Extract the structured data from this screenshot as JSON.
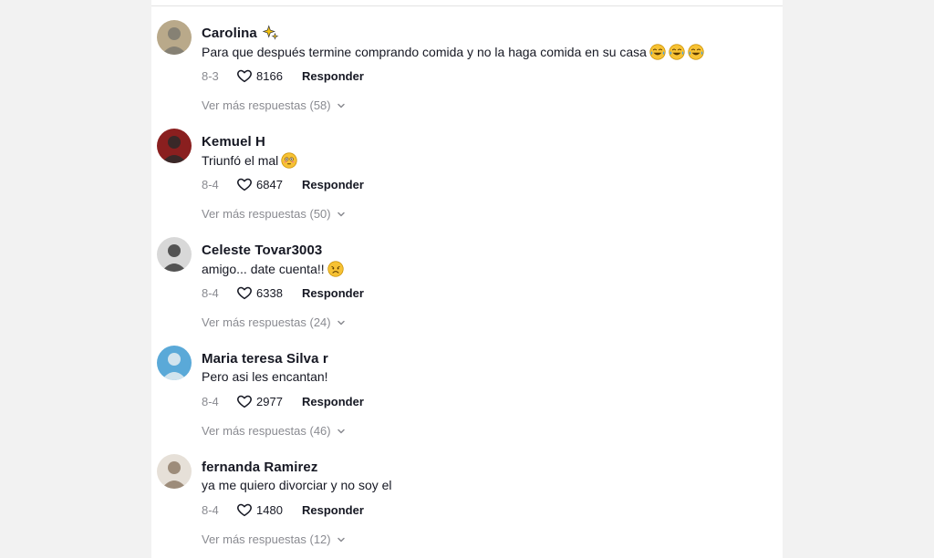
{
  "comments": [
    {
      "username": "Carolina",
      "badge_icon": "sparkle-star-icon",
      "text": "Para que después termine comprando comida y no la haga comida en su casa",
      "emojis": [
        "joy-emoji-icon",
        "joy-emoji-icon",
        "joy-emoji-icon"
      ],
      "date": "8-3",
      "likes": "8166",
      "reply_label": "Responder",
      "more_label": "Ver más respuestas (58)",
      "avatar_colors": [
        "#b9a98a",
        "#7d7a70"
      ]
    },
    {
      "username": "Kemuel H",
      "badge_icon": "",
      "text": "Triunfó el mal",
      "emojis": [
        "flushed-emoji-icon"
      ],
      "date": "8-4",
      "likes": "6847",
      "reply_label": "Responder",
      "more_label": "Ver más respuestas (50)",
      "avatar_colors": [
        "#8a1f1f",
        "#2a2a2a"
      ]
    },
    {
      "username": "Celeste Tovar3003",
      "badge_icon": "",
      "text": "amigo... date cuenta!!",
      "emojis": [
        "frowning-emoji-icon"
      ],
      "date": "8-4",
      "likes": "6338",
      "reply_label": "Responder",
      "more_label": "Ver más respuestas (24)",
      "avatar_colors": [
        "#d8d8d8",
        "#3c3c3c"
      ]
    },
    {
      "username": "Maria teresa Silva r",
      "badge_icon": "",
      "text": "Pero asi les encantan!",
      "emojis": [],
      "date": "8-4",
      "likes": "2977",
      "reply_label": "Responder",
      "more_label": "Ver más respuestas (46)",
      "avatar_colors": [
        "#5aa9d8",
        "#e8eef2"
      ]
    },
    {
      "username": "fernanda Ramirez",
      "badge_icon": "",
      "text": "ya me quiero divorciar y no soy el",
      "emojis": [],
      "date": "8-4",
      "likes": "1480",
      "reply_label": "Responder",
      "more_label": "Ver más respuestas (12)",
      "avatar_colors": [
        "#e6e0d8",
        "#8f7d6a"
      ]
    }
  ],
  "colors": {
    "text_primary": "#161823",
    "text_secondary": "#8a8b91",
    "panel_bg": "#ffffff",
    "page_bg": "#f2f2f2"
  }
}
